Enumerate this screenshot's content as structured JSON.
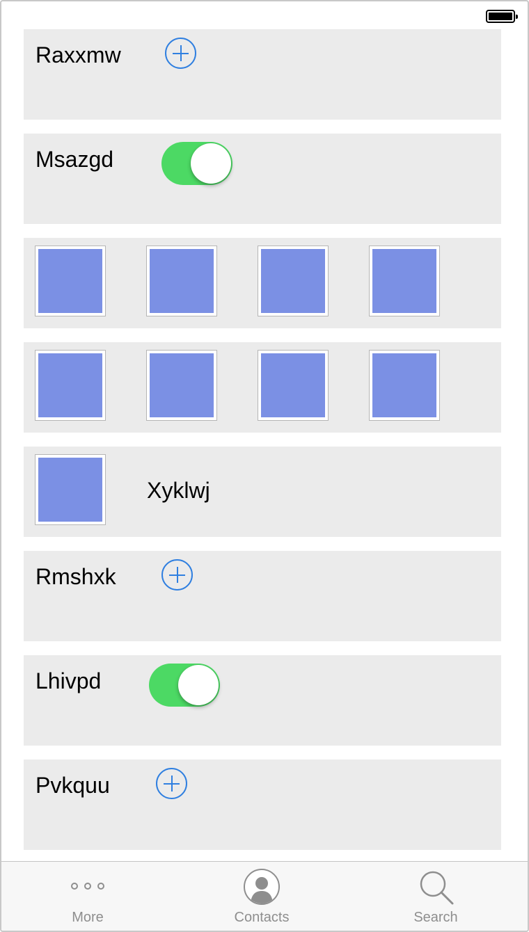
{
  "rows": {
    "r1": {
      "label": "Raxxmw"
    },
    "r2": {
      "label": "Msazgd",
      "toggle_on": true
    },
    "r5": {
      "label": "Xyklwj"
    },
    "r6": {
      "label": "Rmshxk"
    },
    "r7": {
      "label": "Lhivpd",
      "toggle_on": true
    },
    "r8": {
      "label": "Pvkquu"
    }
  },
  "tabs": [
    {
      "label": "More",
      "icon": "more-dots-icon"
    },
    {
      "label": "Contacts",
      "icon": "contact-avatar-icon"
    },
    {
      "label": "Search",
      "icon": "magnifier-icon"
    }
  ],
  "colors": {
    "accent": "#2f7fe0",
    "toggle_on": "#4cd964",
    "row_bg": "#ebebeb",
    "thumbnail": "#7b90e4",
    "tab_inactive": "#8e8e8e"
  }
}
